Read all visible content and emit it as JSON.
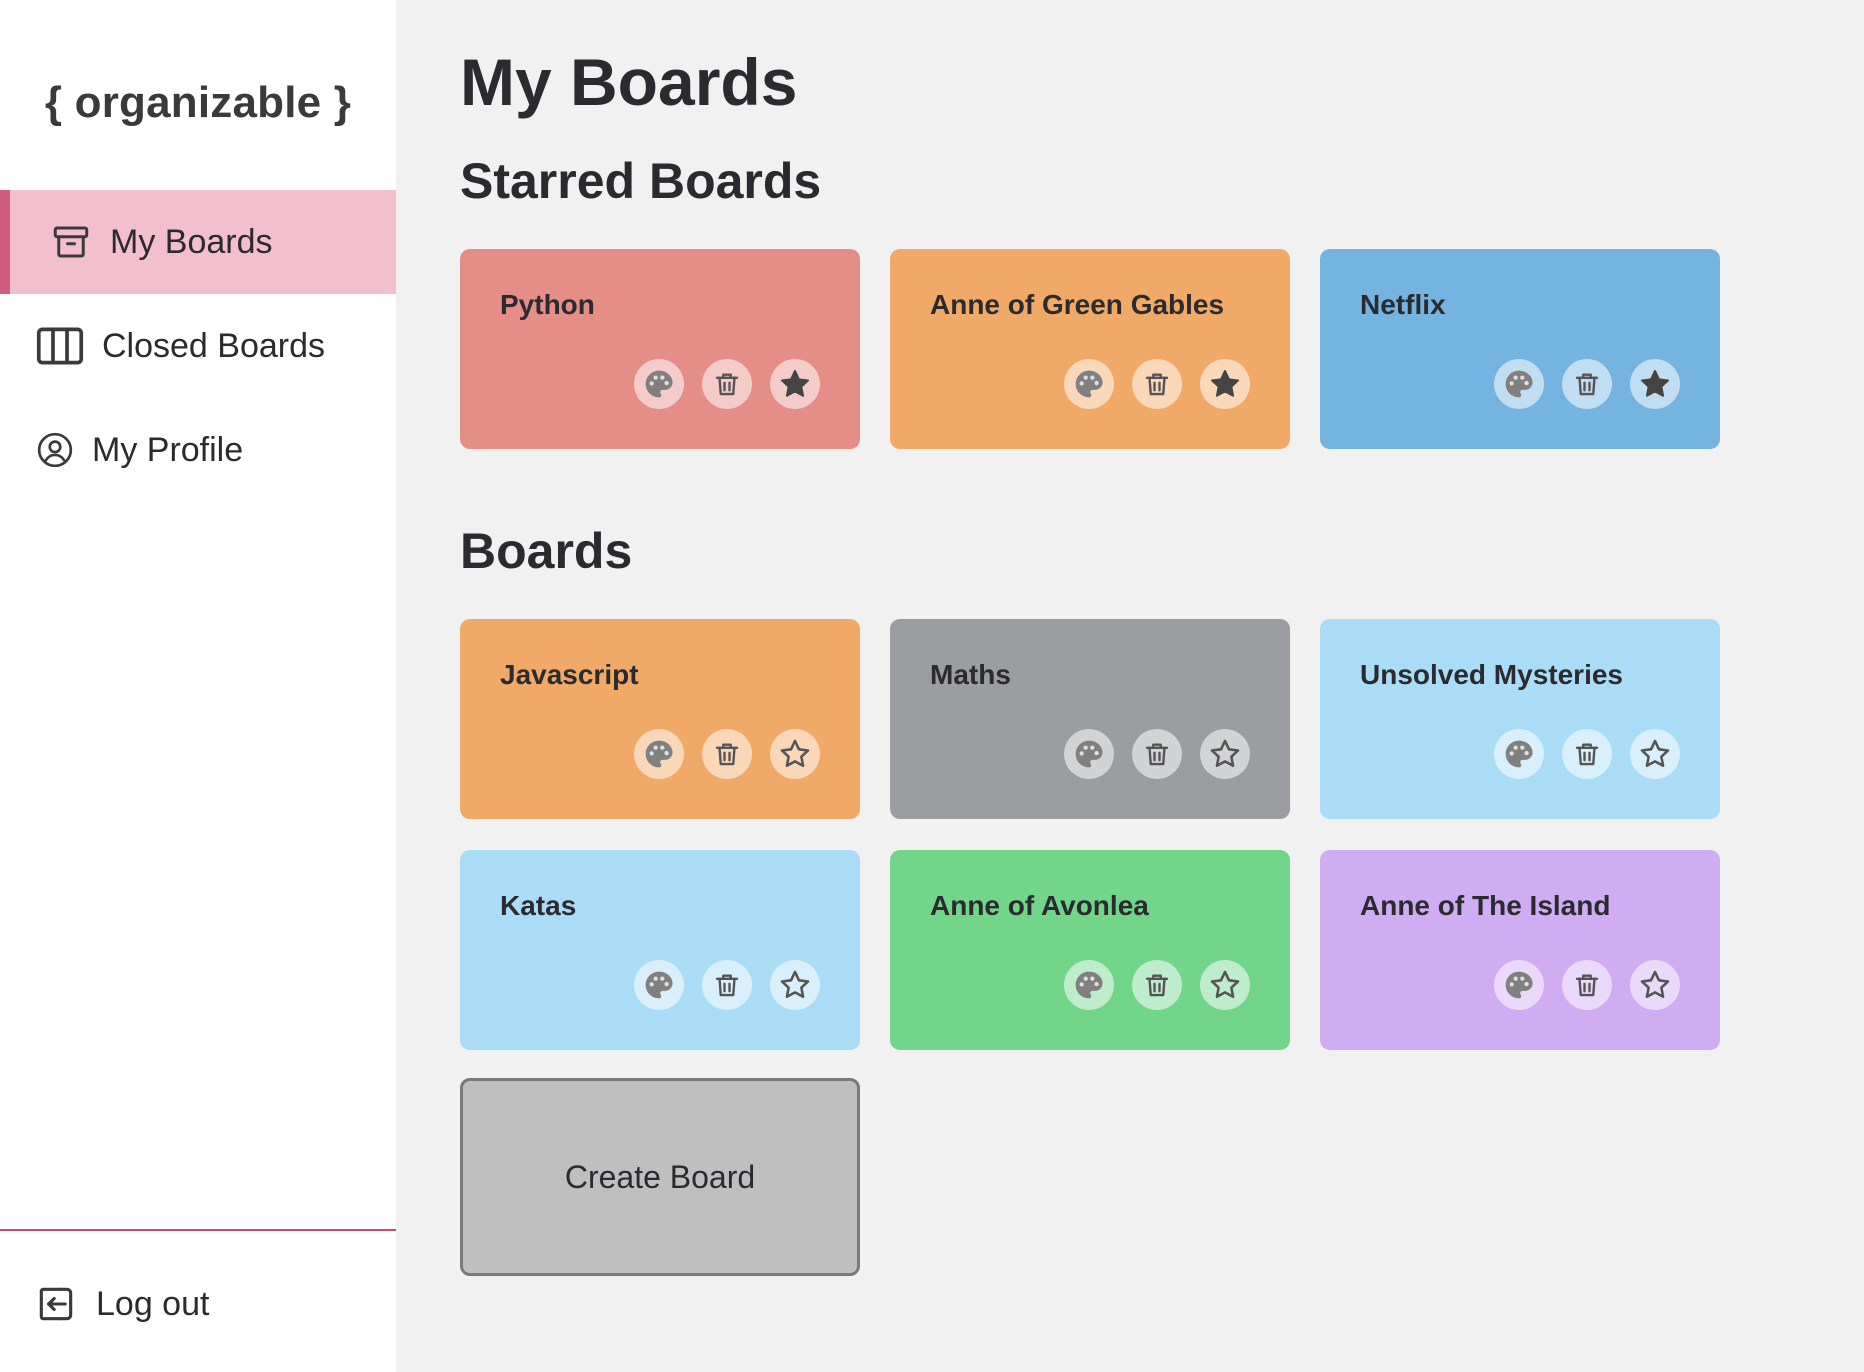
{
  "app": {
    "logo": "{ organizable }"
  },
  "sidebar": {
    "items": [
      {
        "label": "My Boards",
        "icon": "archive-box-icon",
        "active": true
      },
      {
        "label": "Closed Boards",
        "icon": "columns-icon",
        "active": false
      },
      {
        "label": "My Profile",
        "icon": "user-circle-icon",
        "active": false
      }
    ],
    "logout": {
      "label": "Log out",
      "icon": "logout-icon"
    }
  },
  "main": {
    "title": "My Boards",
    "starred_title": "Starred Boards",
    "boards_title": "Boards",
    "starred": [
      {
        "name": "Python",
        "color": "#e48e87",
        "starred": true
      },
      {
        "name": "Anne of Green Gables",
        "color": "#f1a967",
        "starred": true
      },
      {
        "name": "Netflix",
        "color": "#75b3e0",
        "starred": true
      }
    ],
    "boards": [
      {
        "name": "Javascript",
        "color": "#f1a967",
        "starred": false
      },
      {
        "name": "Maths",
        "color": "#9c9da0",
        "starred": false
      },
      {
        "name": "Unsolved Mysteries",
        "color": "#aadcf5",
        "starred": false
      },
      {
        "name": "Katas",
        "color": "#aadcf5",
        "starred": false
      },
      {
        "name": "Anne of Avonlea",
        "color": "#72d68a",
        "starred": false
      },
      {
        "name": "Anne of The Island",
        "color": "#d0acf2",
        "starred": false
      }
    ],
    "create_label": "Create Board"
  },
  "colors": {
    "sidebar_active_bg": "#f2bfcf",
    "sidebar_active_border": "#cf5b80",
    "divider": "#d3476d",
    "page_bg": "#f1f1f1"
  }
}
